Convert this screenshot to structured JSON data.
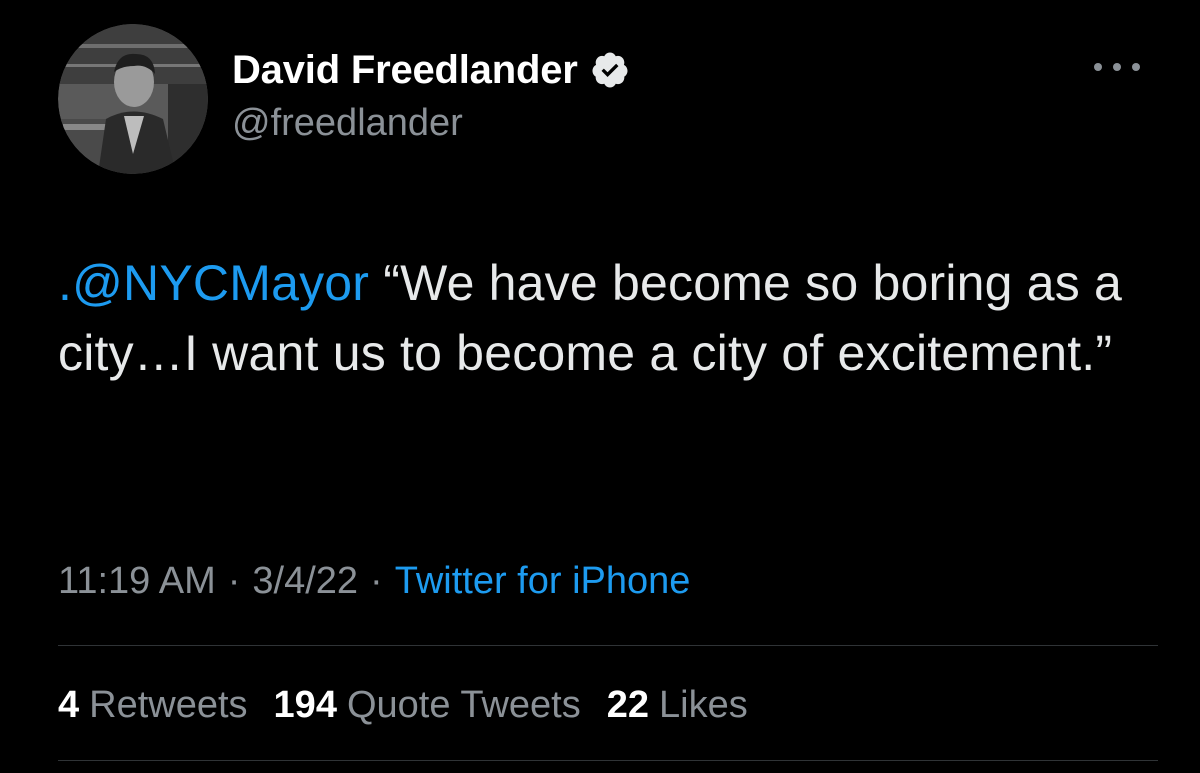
{
  "author": {
    "display_name": "David Freedlander",
    "handle": "@freedlander",
    "verified": true,
    "avatar_icon": "profile-photo"
  },
  "tweet": {
    "mention": ".@NYCMayor",
    "text": " “We have become so boring as a city…I want us to become a city of excitement.”"
  },
  "meta": {
    "time": "11:19 AM",
    "separator": "·",
    "date": "3/4/22",
    "source": "Twitter for iPhone"
  },
  "stats": {
    "retweets_count": "4",
    "retweets_label": "Retweets",
    "quotes_count": "194",
    "quotes_label": "Quote Tweets",
    "likes_count": "22",
    "likes_label": "Likes"
  },
  "colors": {
    "background": "#000000",
    "accent": "#1d9bf0",
    "secondary_text": "#8b9197",
    "primary_text": "#e7e9ea"
  },
  "icons": {
    "verified": "verified-badge-icon",
    "more": "more-options-icon"
  }
}
